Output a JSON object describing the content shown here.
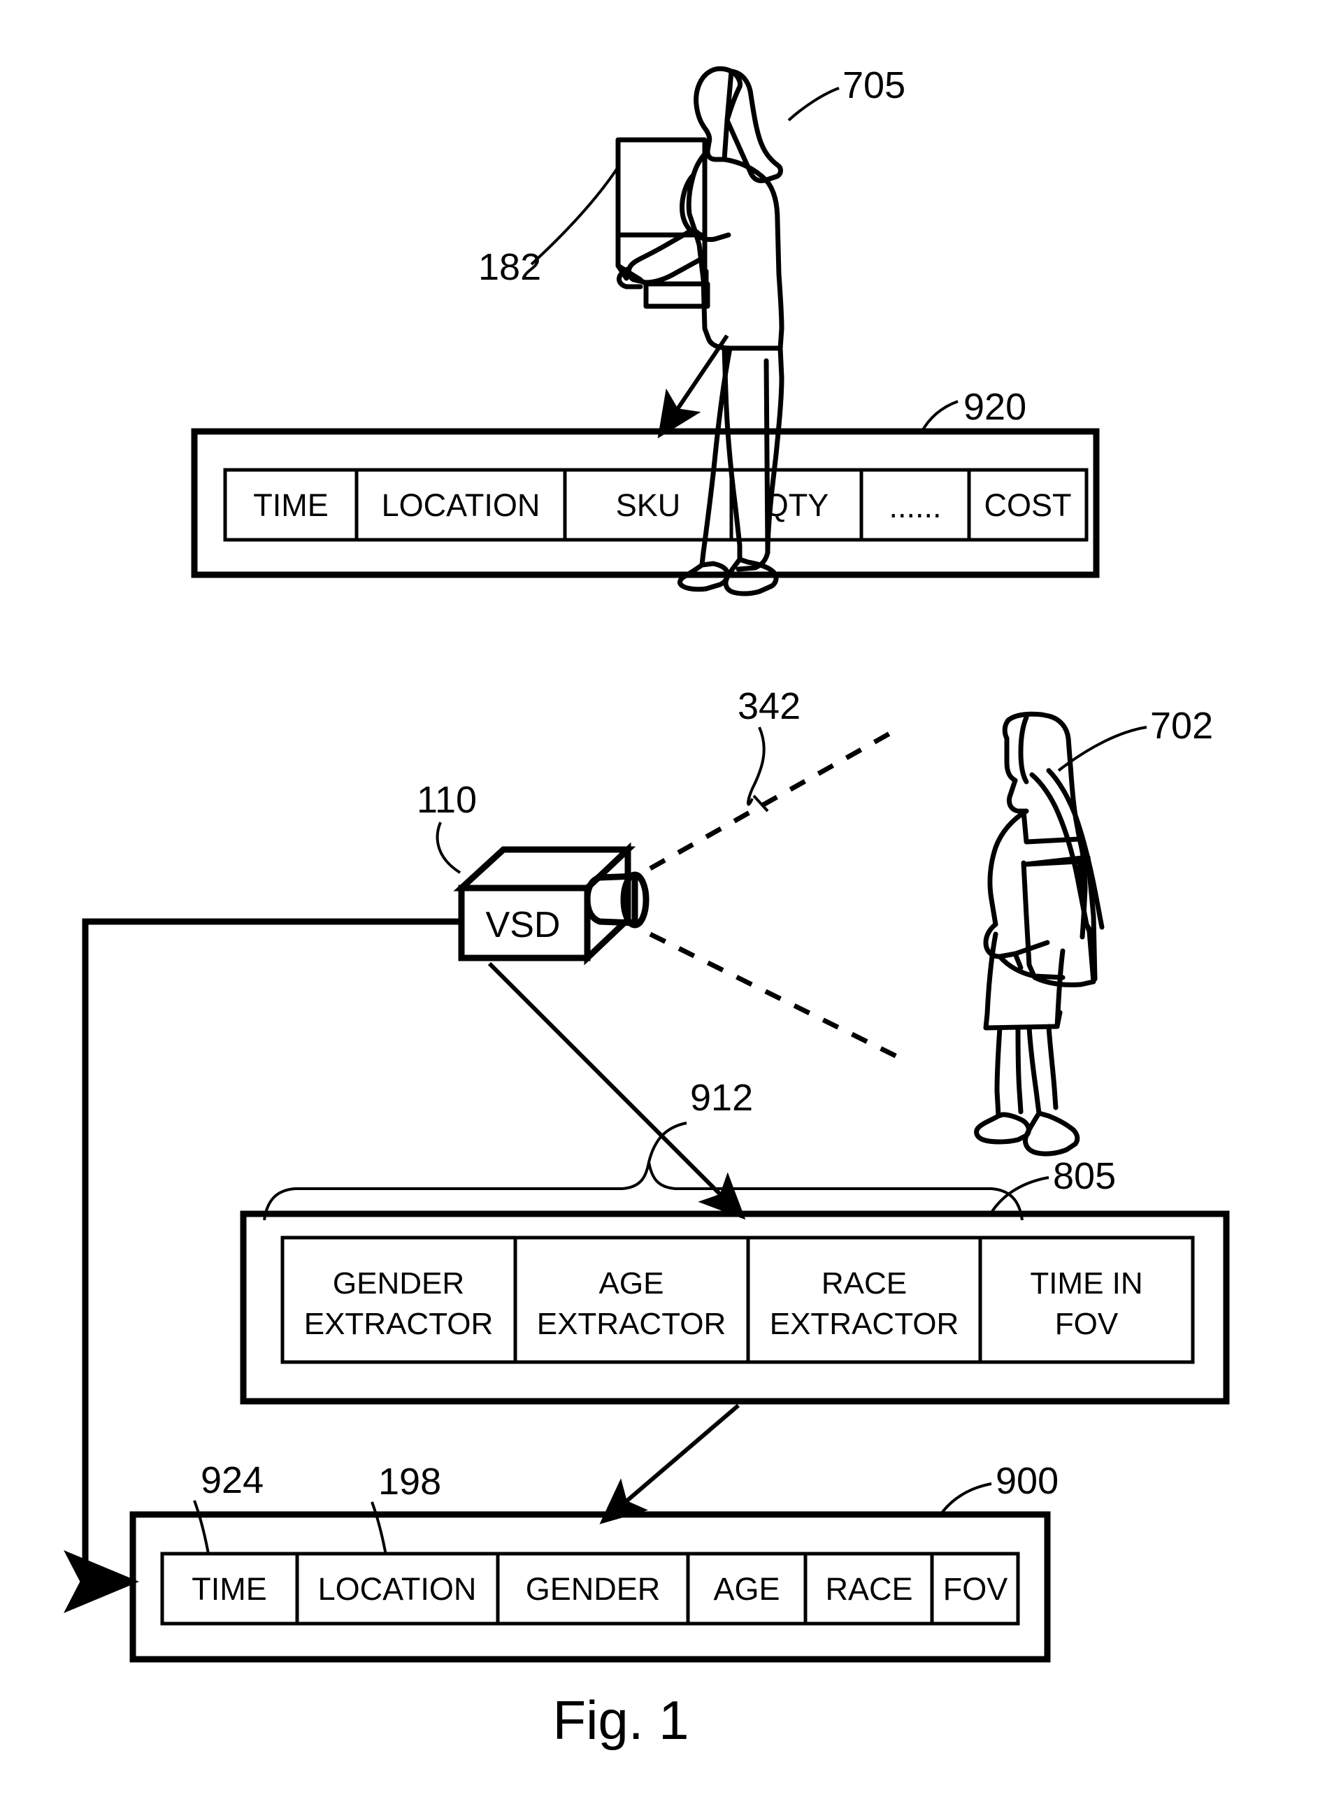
{
  "figure": {
    "caption": "Fig. 1",
    "reference_numerals": {
      "person_with_box": "705",
      "box_item": "182",
      "pos_table": "920",
      "fov_dashed": "342",
      "shopper": "702",
      "vsd_device": "110",
      "extractor_brace": "912",
      "extractor_panel": "805",
      "time_column": "924",
      "location_column": "198",
      "demographic_table": "900"
    },
    "vsd": {
      "label": "VSD"
    },
    "pos_table": {
      "name": "920",
      "columns": [
        "TIME",
        "LOCATION",
        "SKU",
        "QTY",
        "......",
        "COST"
      ]
    },
    "extractor_panel": {
      "name": "805",
      "cells": [
        {
          "line1": "GENDER",
          "line2": "EXTRACTOR"
        },
        {
          "line1": "AGE",
          "line2": "EXTRACTOR"
        },
        {
          "line1": "RACE",
          "line2": "EXTRACTOR"
        },
        {
          "line1": "TIME IN",
          "line2": "FOV"
        }
      ]
    },
    "demographic_table": {
      "name": "900",
      "columns": [
        "TIME",
        "LOCATION",
        "GENDER",
        "AGE",
        "RACE",
        "FOV"
      ]
    },
    "colors": {
      "ink": "#000000",
      "paper": "#ffffff"
    }
  }
}
